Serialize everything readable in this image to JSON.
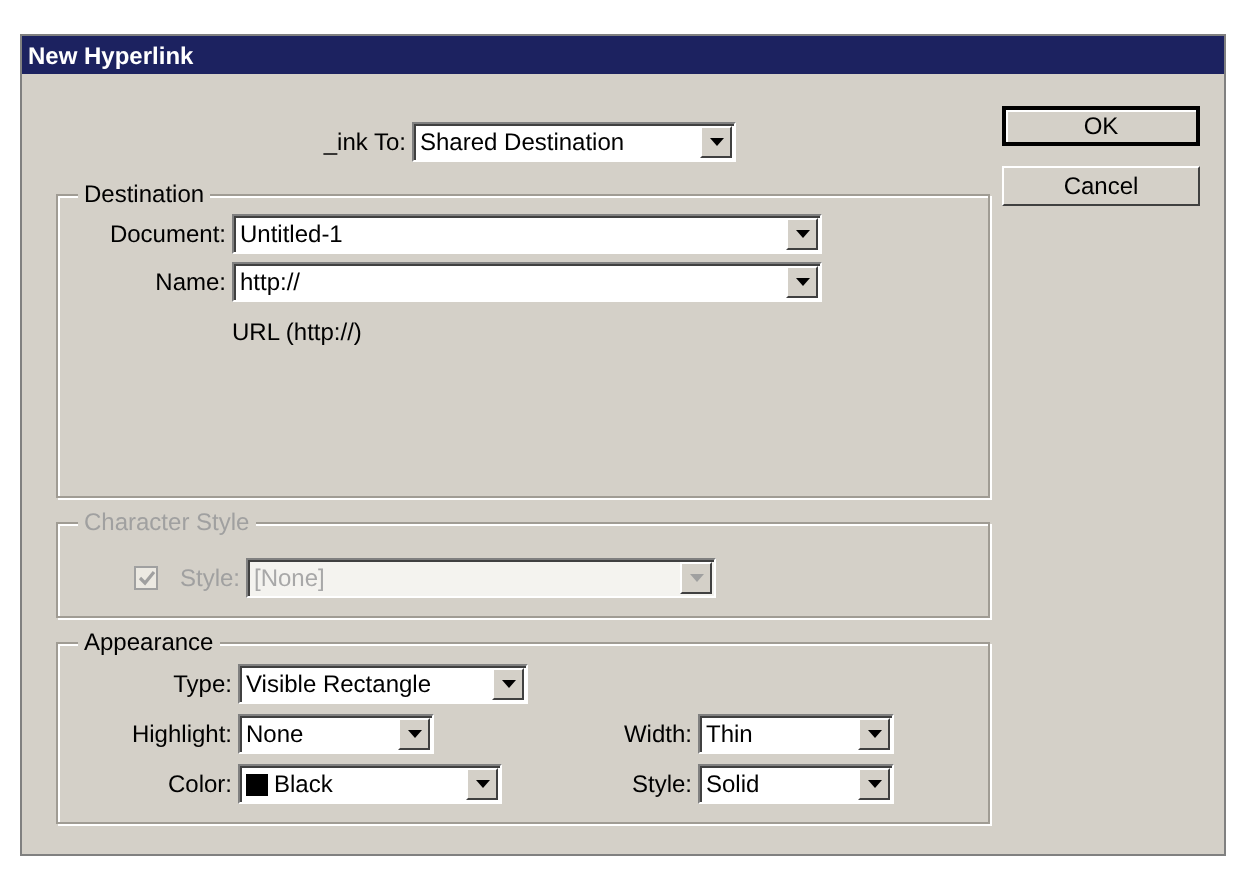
{
  "window": {
    "title": "New Hyperlink"
  },
  "link_to": {
    "label": "_ink To:",
    "value": "Shared Destination"
  },
  "destination": {
    "legend": "Destination",
    "fields": [
      {
        "label": "Document:",
        "value": "Untitled-1"
      },
      {
        "label": "Name:",
        "value": "http://"
      }
    ],
    "url_note": "URL (http://)"
  },
  "character_style": {
    "legend": "Character Style",
    "disabled": true,
    "checked": true,
    "label": "Style:",
    "value": "[None]"
  },
  "appearance": {
    "legend": "Appearance",
    "type": {
      "label": "Type:",
      "value": "Visible Rectangle"
    },
    "highlight": {
      "label": "Highlight:",
      "value": "None"
    },
    "color": {
      "label": "Color:",
      "value": "Black",
      "color": "#000000"
    },
    "width": {
      "label": "Width:",
      "value": "Thin"
    },
    "style": {
      "label": "Style:",
      "value": "Solid"
    }
  },
  "buttons": [
    {
      "label": "OK",
      "default": true
    },
    {
      "label": "Cancel",
      "default": false
    }
  ]
}
